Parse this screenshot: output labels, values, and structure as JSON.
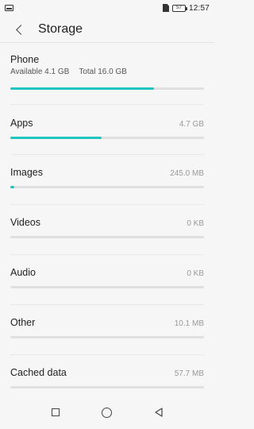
{
  "status_bar": {
    "time": "12:57",
    "battery_level": "57"
  },
  "app_bar": {
    "title": "Storage"
  },
  "phone": {
    "title": "Phone",
    "available": "Available 4.1 GB",
    "total": "Total 16.0 GB",
    "used_fraction": 0.74
  },
  "categories": [
    {
      "label": "Apps",
      "size": "4.7 GB",
      "fraction": 0.47
    },
    {
      "label": "Images",
      "size": "245.0 MB",
      "fraction": 0.02
    },
    {
      "label": "Videos",
      "size": "0 KB",
      "fraction": 0
    },
    {
      "label": "Audio",
      "size": "0 KB",
      "fraction": 0
    },
    {
      "label": "Other",
      "size": "10.1 MB",
      "fraction": 0
    },
    {
      "label": "Cached data",
      "size": "57.7 MB",
      "fraction": 0
    }
  ],
  "colors": {
    "accent": "#22c4c0",
    "track": "#e0e0e0"
  },
  "icons": {
    "back": "back-chevron-icon",
    "nav_recent": "square-icon",
    "nav_home": "circle-icon",
    "nav_back": "triangle-back-icon"
  }
}
